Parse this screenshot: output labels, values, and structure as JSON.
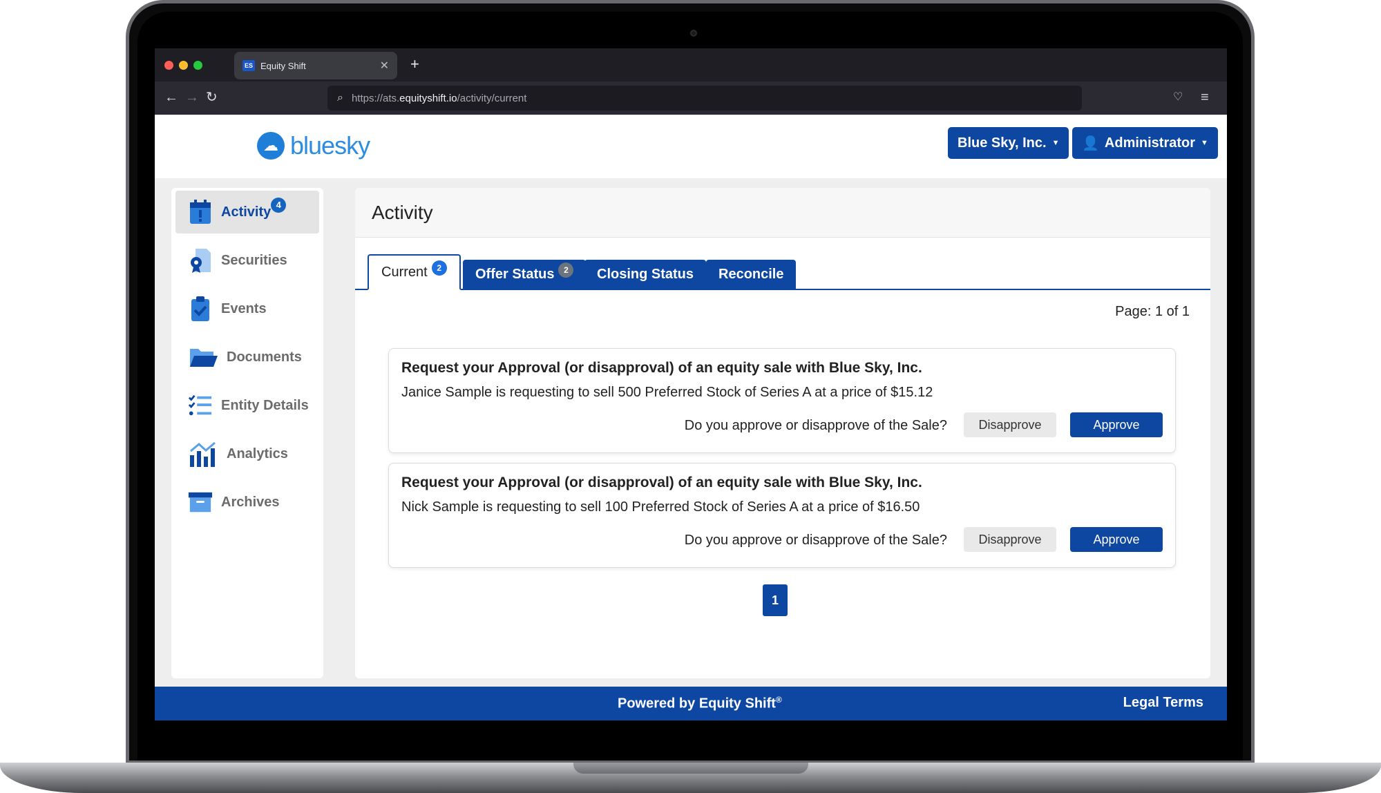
{
  "browser": {
    "tab_title": "Equity Shift",
    "favicon_text": "ES",
    "url_prefix": "https://ats.",
    "url_host": "equityshift.io",
    "url_path": "/activity/current"
  },
  "header": {
    "logo_text": "bluesky",
    "company_button": "Blue Sky, Inc.",
    "user_button": "Administrator"
  },
  "sidebar": {
    "items": [
      {
        "label": "Activity",
        "badge": "4",
        "icon": "calendar-alert-icon"
      },
      {
        "label": "Securities",
        "icon": "certificate-icon"
      },
      {
        "label": "Events",
        "icon": "clipboard-check-icon"
      },
      {
        "label": "Documents",
        "icon": "folder-icon"
      },
      {
        "label": "Entity Details",
        "icon": "checklist-icon"
      },
      {
        "label": "Analytics",
        "icon": "chart-icon"
      },
      {
        "label": "Archives",
        "icon": "archive-box-icon"
      }
    ]
  },
  "main": {
    "title": "Activity",
    "tabs": [
      {
        "label": "Current",
        "badge": "2"
      },
      {
        "label": "Offer Status",
        "badge": "2"
      },
      {
        "label": "Closing Status"
      },
      {
        "label": "Reconcile"
      }
    ],
    "page_info": "Page: 1 of 1",
    "cards": [
      {
        "title": "Request your Approval (or disapproval) of an equity sale with Blue Sky, Inc.",
        "body": "Janice Sample is requesting to sell 500 Preferred Stock of Series A at a price of $15.12",
        "question": "Do you approve or disapprove of the Sale?",
        "disapprove": "Disapprove",
        "approve": "Approve"
      },
      {
        "title": "Request your Approval (or disapproval) of an equity sale with Blue Sky, Inc.",
        "body": "Nick Sample is requesting to sell 100 Preferred Stock of Series A at a price of $16.50",
        "question": "Do you approve or disapprove of the Sale?",
        "disapprove": "Disapprove",
        "approve": "Approve"
      }
    ],
    "pagination": [
      "1"
    ]
  },
  "footer": {
    "powered_by": "Powered by Equity Shift",
    "registered": "®",
    "legal": "Legal Terms"
  },
  "colors": {
    "primary": "#0d47a1",
    "badge": "#1565c0",
    "logo": "#2b8ce0"
  }
}
